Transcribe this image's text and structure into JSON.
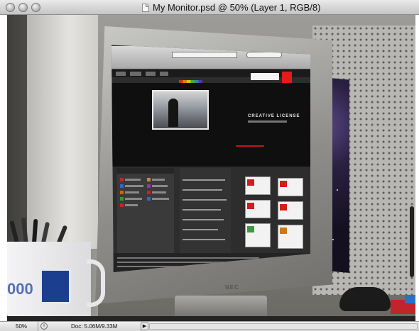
{
  "window": {
    "title": "My Monitor.psd @ 50% (Layer 1, RGB/8)",
    "buttons": [
      "close",
      "minimize",
      "zoom"
    ]
  },
  "status_bar": {
    "zoom": "50%",
    "doc_info": "Doc: 5.06M/9.33M",
    "info_icon": "status-info-icon",
    "arrow": "▶"
  },
  "photo": {
    "monitor_brand": "NEC",
    "hero_text": "CREATIVE LICENSE",
    "mug_text": "000"
  },
  "colors": {
    "adobe_red": "#e21b1b",
    "window_chrome": "#c4c4c4",
    "screen_dark": "#2d2d2d"
  }
}
